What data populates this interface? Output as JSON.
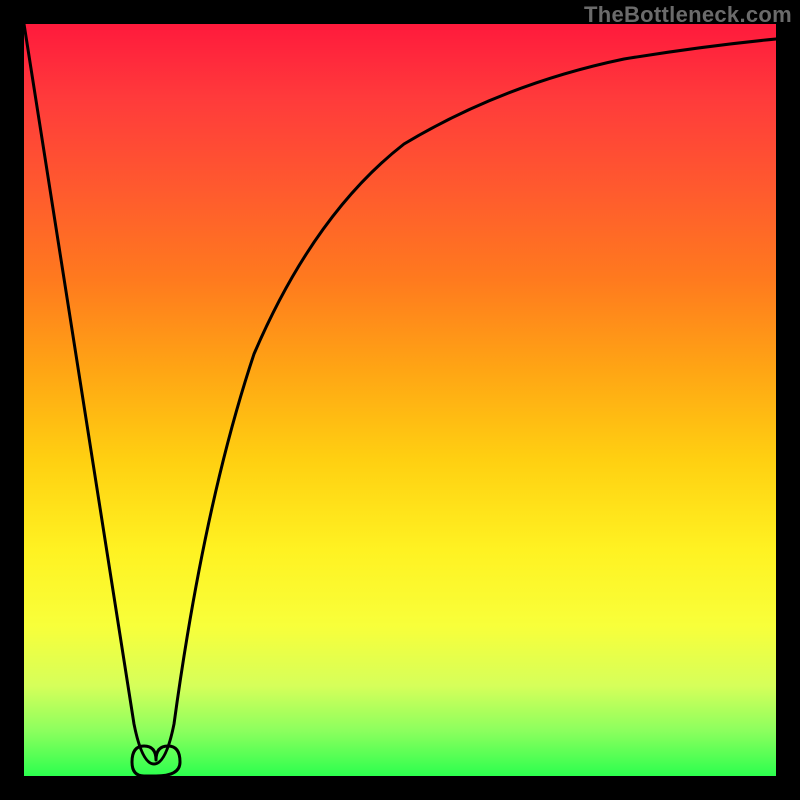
{
  "watermark": "TheBottleneck.com",
  "chart_data": {
    "type": "line",
    "title": "",
    "xlabel": "",
    "ylabel": "",
    "xlim": [
      0,
      100
    ],
    "ylim": [
      0,
      100
    ],
    "series": [
      {
        "name": "bottleneck-curve",
        "x": [
          0,
          4,
          8,
          12,
          13,
          14,
          15,
          16,
          17,
          18,
          22,
          28,
          36,
          46,
          58,
          72,
          86,
          100
        ],
        "values": [
          100,
          75,
          50,
          25,
          12,
          3,
          0,
          0,
          3,
          12,
          35,
          55,
          70,
          80,
          87,
          92,
          95,
          97
        ]
      }
    ],
    "annotations": [
      {
        "name": "optimal-point",
        "x": 15.5,
        "y": 0
      }
    ],
    "gradient_stops": [
      {
        "pos": 0,
        "color": "#ff1a3c"
      },
      {
        "pos": 50,
        "color": "#ffd011"
      },
      {
        "pos": 80,
        "color": "#fff222"
      },
      {
        "pos": 100,
        "color": "#2cff4e"
      }
    ]
  }
}
